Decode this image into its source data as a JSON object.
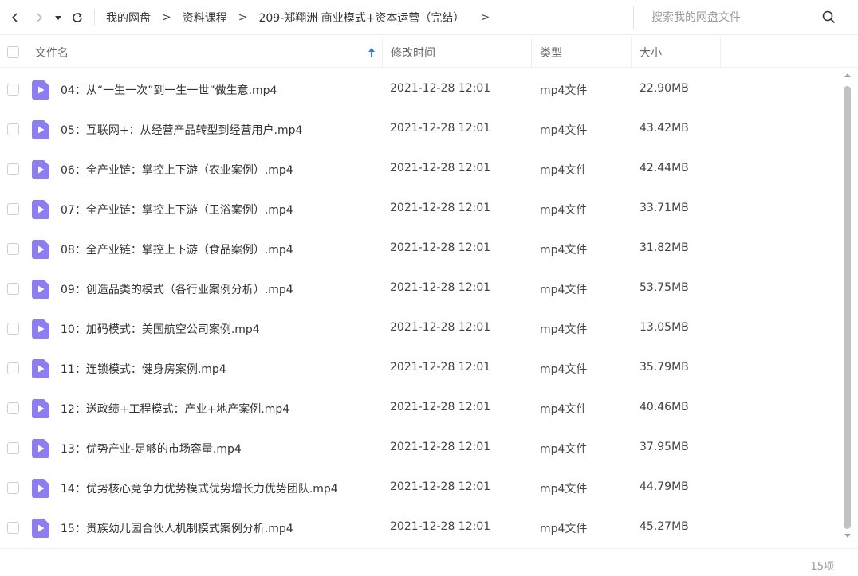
{
  "toolbar": {
    "breadcrumbs": [
      "我的网盘",
      "资料课程",
      "209-郑翔洲 商业模式+资本运营（完结）"
    ],
    "search_placeholder": "搜索我的网盘文件"
  },
  "columns": {
    "name": "文件名",
    "date": "修改时间",
    "type": "类型",
    "size": "大小"
  },
  "files": [
    {
      "name": "04：从“一生一次”到一生一世”做生意.mp4",
      "date": "2021-12-28 12:01",
      "type": "mp4文件",
      "size": "22.90MB"
    },
    {
      "name": "05：互联网+：从经营产品转型到经营用户.mp4",
      "date": "2021-12-28 12:01",
      "type": "mp4文件",
      "size": "43.42MB"
    },
    {
      "name": "06：全产业链：掌控上下游（农业案例）.mp4",
      "date": "2021-12-28 12:01",
      "type": "mp4文件",
      "size": "42.44MB"
    },
    {
      "name": "07：全产业链：掌控上下游（卫浴案例）.mp4",
      "date": "2021-12-28 12:01",
      "type": "mp4文件",
      "size": "33.71MB"
    },
    {
      "name": "08：全产业链：掌控上下游（食品案例）.mp4",
      "date": "2021-12-28 12:01",
      "type": "mp4文件",
      "size": "31.82MB"
    },
    {
      "name": "09：创造品类的模式（各行业案例分析）.mp4",
      "date": "2021-12-28 12:01",
      "type": "mp4文件",
      "size": "53.75MB"
    },
    {
      "name": "10：加码模式：美国航空公司案例.mp4",
      "date": "2021-12-28 12:01",
      "type": "mp4文件",
      "size": "13.05MB"
    },
    {
      "name": "11：连锁模式：健身房案例.mp4",
      "date": "2021-12-28 12:01",
      "type": "mp4文件",
      "size": "35.79MB"
    },
    {
      "name": "12：送政绩+工程模式：产业+地产案例.mp4",
      "date": "2021-12-28 12:01",
      "type": "mp4文件",
      "size": "40.46MB"
    },
    {
      "name": "13：优势产业-足够的市场容量.mp4",
      "date": "2021-12-28 12:01",
      "type": "mp4文件",
      "size": "37.95MB"
    },
    {
      "name": "14：优势核心竞争力优势模式优势增长力优势团队.mp4",
      "date": "2021-12-28 12:01",
      "type": "mp4文件",
      "size": "44.79MB"
    },
    {
      "name": "15：贵族幼儿园合伙人机制模式案例分析.mp4",
      "date": "2021-12-28 12:01",
      "type": "mp4文件",
      "size": "45.27MB"
    }
  ],
  "footer": {
    "count": "15项"
  },
  "colors": {
    "accent": "#2b7cf6",
    "file_icon": "#8c7ef0"
  }
}
